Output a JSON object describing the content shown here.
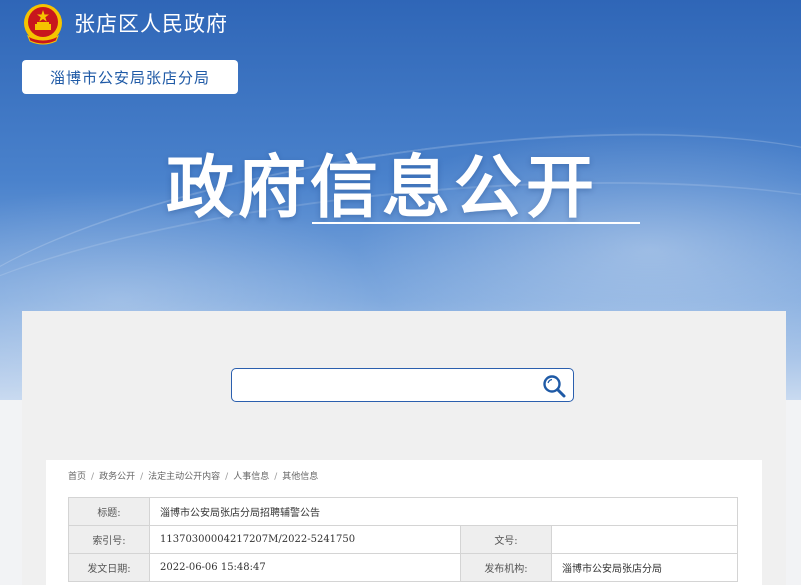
{
  "header": {
    "site_title": "张店区人民政府",
    "department": "淄博市公安局张店分局",
    "emblem_icon": "national-emblem-icon"
  },
  "hero": {
    "title": "政府信息公开"
  },
  "search": {
    "placeholder": "",
    "icon": "search-icon"
  },
  "breadcrumb": {
    "items": [
      "首页",
      "政务公开",
      "法定主动公开内容",
      "人事信息",
      "其他信息"
    ]
  },
  "meta": {
    "title_label": "标题:",
    "title_value": "淄博市公安局张店分局招聘辅警公告",
    "index_label": "索引号:",
    "index_value": "11370300004217207M/2022-5241750",
    "docno_label": "文号:",
    "docno_value": "",
    "date_label": "发文日期:",
    "date_value": "2022-06-06 15:48:47",
    "org_label": "发布机构:",
    "org_value": "淄博市公安局张店分局"
  },
  "colors": {
    "banner_top": "#2f66b7",
    "accent": "#1f5aa6",
    "emblem_red": "#c8161d",
    "emblem_gold": "#f5c400"
  }
}
